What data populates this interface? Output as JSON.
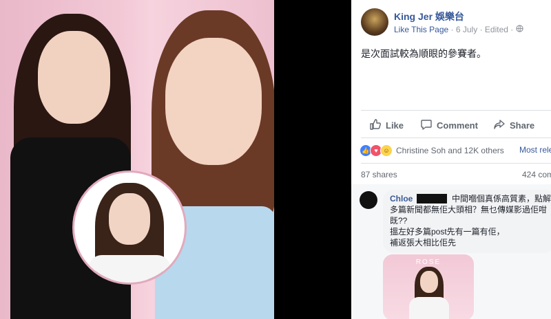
{
  "post": {
    "page_name": "King Jer 娛樂台",
    "like_page": "Like This Page",
    "date": "6 July",
    "edited": "Edited",
    "separator": "·",
    "text": "是次面試較為順眼的參賽者。"
  },
  "actions": {
    "like": "Like",
    "comment": "Comment",
    "share": "Share"
  },
  "engagement": {
    "reactors": "Christine Soh and 12K others",
    "most_relevant": "Most rele",
    "shares": "87 shares",
    "comments": "424 com"
  },
  "comment": {
    "author": "Chloe",
    "lines": [
      "中間嗰個真係高質素，點解咁",
      "多篇新聞都無佢大頭相？無乜傳媒影過佢咁",
      "既??",
      "搵左好多篇post先有一篇有佢，",
      "補返張大相比佢先"
    ]
  },
  "photo_caption": "ROSE",
  "colors": {
    "link": "#365899",
    "text": "#1d2129",
    "muted": "#606770",
    "like_blue": "#4080ff"
  },
  "icons": [
    "thumbs-up-icon",
    "comment-icon",
    "share-icon",
    "globe-icon",
    "more-icon"
  ]
}
